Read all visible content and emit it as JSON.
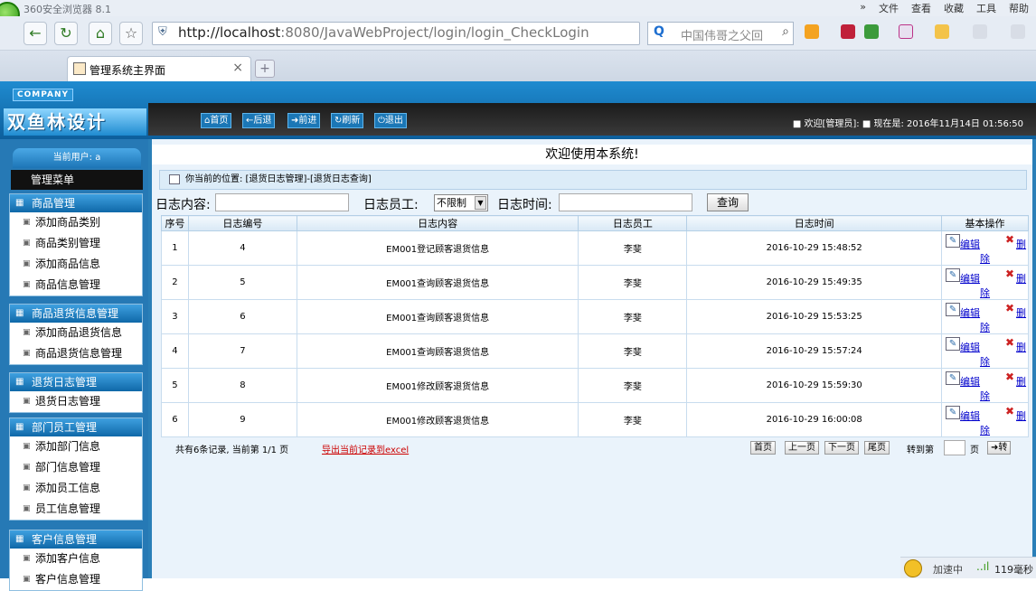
{
  "browser": {
    "name": "360安全浏览器 8.1",
    "menus": [
      "»",
      "文件",
      "查看",
      "收藏",
      "工具",
      "帮助"
    ],
    "url_host": "http://localhost",
    "url_path": ":8080/JavaWebProject/login/login_CheckLogin",
    "search_placeholder": "中国伟哥之父回",
    "tab_title": "管理系统主界面",
    "tab_close": "×",
    "new_tab": "+",
    "status": {
      "text": "加速中",
      "signal": "..ıl",
      "ms": "119毫秒"
    }
  },
  "header": {
    "company": "COMPANY",
    "logo": "双鱼林设计",
    "buttons": [
      "首页",
      "后退",
      "前进",
      "刷新",
      "退出"
    ],
    "welcome": "■ 欢迎[管理员]: ■ 现在是: 2016年11月14日 01:56:50"
  },
  "sidebar": {
    "current_user": "当前用户: a",
    "menu_title": "管理菜单",
    "groups": [
      {
        "title": "商品管理",
        "items": [
          "添加商品类别",
          "商品类别管理",
          "添加商品信息",
          "商品信息管理"
        ]
      },
      {
        "title": "商品退货信息管理",
        "items": [
          "添加商品退货信息",
          "商品退货信息管理"
        ]
      },
      {
        "title": "退货日志管理",
        "items": [
          "退货日志管理"
        ]
      },
      {
        "title": "部门员工管理",
        "items": [
          "添加部门信息",
          "部门信息管理",
          "添加员工信息",
          "员工信息管理"
        ]
      },
      {
        "title": "客户信息管理",
        "items": [
          "添加客户信息",
          "客户信息管理"
        ]
      }
    ]
  },
  "main": {
    "welcome": "欢迎使用本系统!",
    "location": "你当前的位置: [退货日志管理]-[退货日志查询]",
    "filters": {
      "content_label": "日志内容:",
      "employee_label": "日志员工:",
      "employee_value": "不限制",
      "time_label": "日志时间:",
      "query_button": "查询"
    },
    "table": {
      "headers": [
        "序号",
        "日志编号",
        "日志内容",
        "日志员工",
        "日志时间",
        "基本操作"
      ],
      "edit_label": "编辑",
      "delete_label_a": "删",
      "delete_label_b": "除",
      "rows": [
        [
          "1",
          "4",
          "EM001登记顾客退货信息",
          "李斐",
          "2016-10-29 15:48:52"
        ],
        [
          "2",
          "5",
          "EM001查询顾客退货信息",
          "李斐",
          "2016-10-29 15:49:35"
        ],
        [
          "3",
          "6",
          "EM001查询顾客退货信息",
          "李斐",
          "2016-10-29 15:53:25"
        ],
        [
          "4",
          "7",
          "EM001查询顾客退货信息",
          "李斐",
          "2016-10-29 15:57:24"
        ],
        [
          "5",
          "8",
          "EM001修改顾客退货信息",
          "李斐",
          "2016-10-29 15:59:30"
        ],
        [
          "6",
          "9",
          "EM001修改顾客退货信息",
          "李斐",
          "2016-10-29 16:00:08"
        ]
      ]
    },
    "pager": {
      "info": "共有6条记录, 当前第 1/1 页",
      "export": "导出当前记录到excel",
      "buttons": [
        "首页",
        "上一页",
        "下一页",
        "尾页"
      ],
      "goto_label": "转到第",
      "page_unit": "页",
      "go_button": "➜转"
    }
  }
}
